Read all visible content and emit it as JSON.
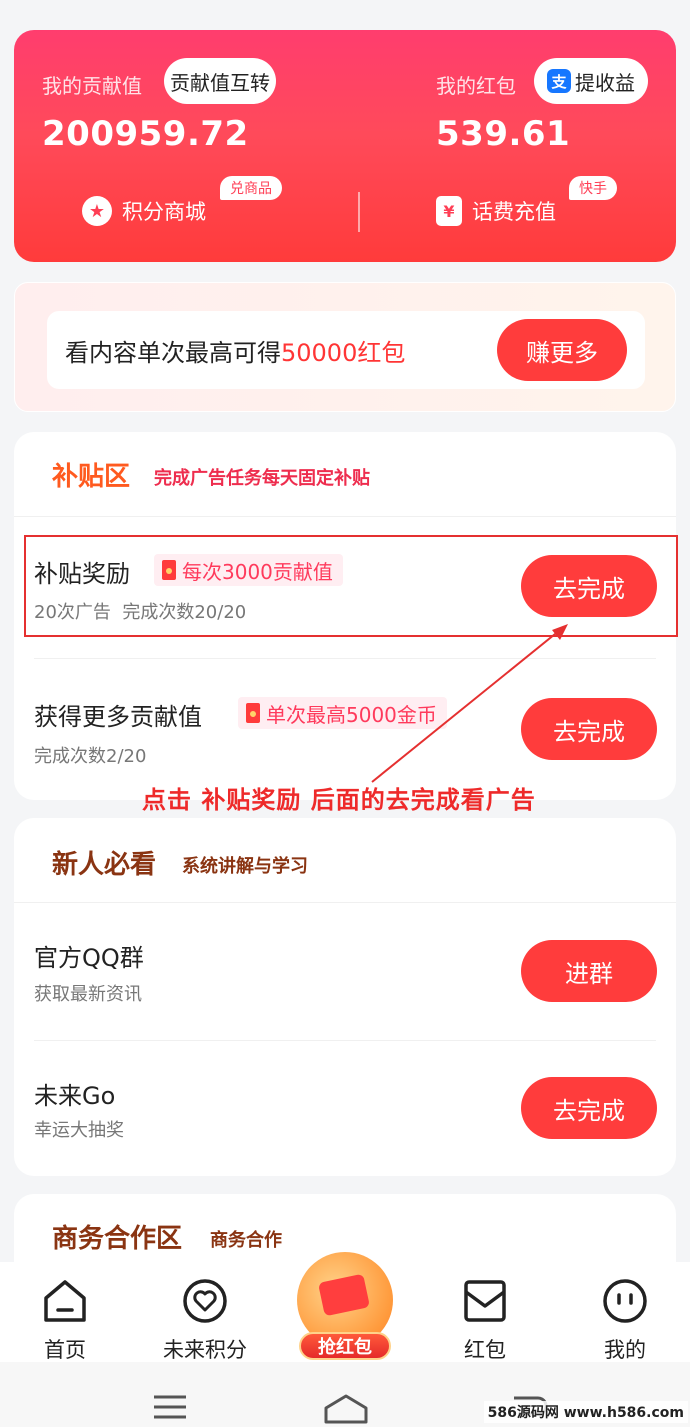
{
  "account": {
    "contribution_label": "我的贡献值",
    "transfer_button": "贡献值互转",
    "contribution_value": "200959.72",
    "redpacket_label": "我的红包",
    "withdraw_button": "提收益",
    "alipay_glyph": "支",
    "redpacket_value": "539.61",
    "points_mall_label": "积分商城",
    "points_mall_tag": "兑商品",
    "recharge_label": "话费充值",
    "recharge_tag": "快手",
    "recharge_glyph": "¥"
  },
  "promo": {
    "text_prefix": "看内容单次最高可得",
    "text_highlight": "50000红包",
    "button": "赚更多"
  },
  "subsidy": {
    "title": "补贴区",
    "subtitle": "完成广告任务每天固定补贴",
    "tasks": [
      {
        "title": "补贴奖励",
        "reward": "每次3000贡献值",
        "sub_a": "20次广告",
        "sub_b": "完成次数20/20",
        "button": "去完成"
      },
      {
        "title": "获得更多贡献值",
        "reward": "单次最高5000金币",
        "sub_a": "完成次数2/20",
        "button": "去完成"
      }
    ]
  },
  "annotation": "点击 补贴奖励 后面的去完成看广告",
  "newbie": {
    "title": "新人必看",
    "subtitle": "系统讲解与学习",
    "items": [
      {
        "title": "官方QQ群",
        "sub": "获取最新资讯",
        "button": "进群"
      },
      {
        "title": "未来Go",
        "sub": "幸运大抽奖",
        "button": "去完成"
      }
    ]
  },
  "business": {
    "title": "商务合作区",
    "subtitle": "商务合作"
  },
  "bottom_nav": {
    "items": [
      {
        "label": "首页",
        "icon": "home-icon"
      },
      {
        "label": "未来积分",
        "icon": "heart-icon"
      },
      {
        "label": "抢红包",
        "icon": "red-packet-icon"
      },
      {
        "label": "红包",
        "icon": "envelope-icon"
      },
      {
        "label": "我的",
        "icon": "face-icon"
      }
    ]
  },
  "watermark": "586源码网 www.h586.com",
  "colors": {
    "brand_red": "#ff3c3c",
    "card_gradient_top": "#ff3d6e",
    "section_title_orange": "#ff5a1f",
    "section_title_brown": "#8a3412"
  }
}
